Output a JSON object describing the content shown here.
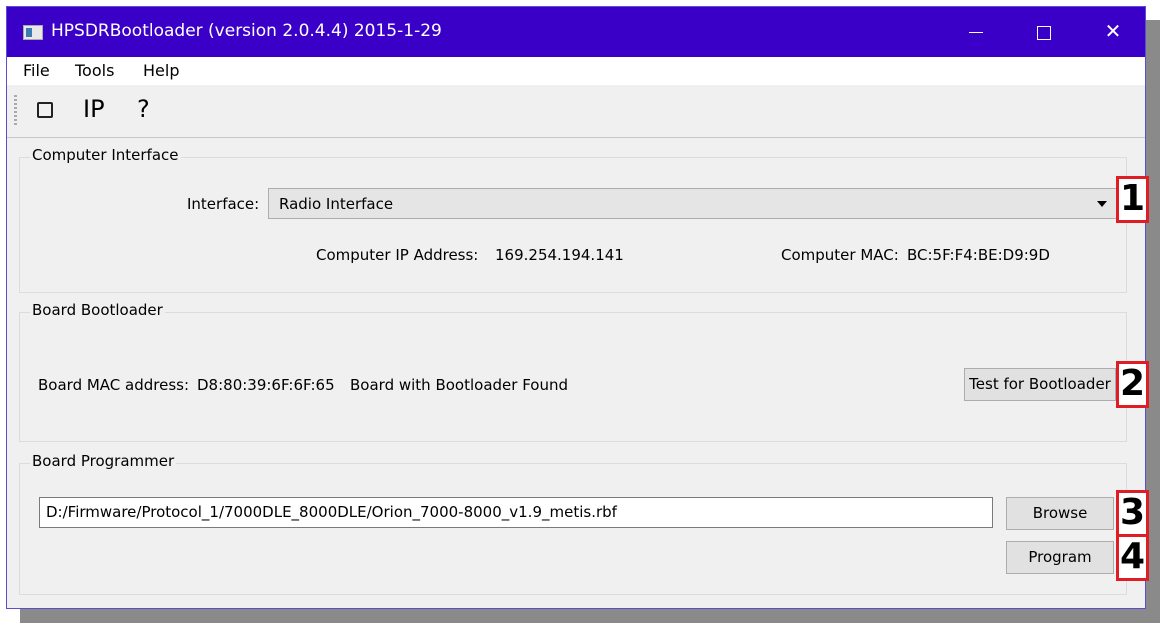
{
  "window": {
    "title": "HPSDRBootloader (version 2.0.4.4) 2015-1-29"
  },
  "menu": [
    "File",
    "Tools",
    "Help"
  ],
  "toolbar": {
    "ip_label": "IP",
    "help_label": "?"
  },
  "computer_interface": {
    "group_title": "Computer Interface",
    "interface_label": "Interface:",
    "interface_value": "Radio Interface",
    "ip_label": "Computer IP Address:",
    "ip_value": "169.254.194.141",
    "mac_label": "Computer MAC:",
    "mac_value": "BC:5F:F4:BE:D9:9D"
  },
  "board_bootloader": {
    "group_title": "Board Bootloader",
    "mac_label": "Board MAC address:",
    "mac_value": "D8:80:39:6F:6F:65",
    "status": "Board with Bootloader Found",
    "test_button": "Test for Bootloader"
  },
  "board_programmer": {
    "group_title": "Board Programmer",
    "file_path": "D:/Firmware/Protocol_1/7000DLE_8000DLE/Orion_7000-8000_v1.9_metis.rbf",
    "browse_button": "Browse",
    "program_button": "Program"
  },
  "annotations": [
    "1",
    "2",
    "3",
    "4"
  ],
  "colors": {
    "titlebar": "#3a00c8",
    "annotation_border": "#e01c24"
  }
}
